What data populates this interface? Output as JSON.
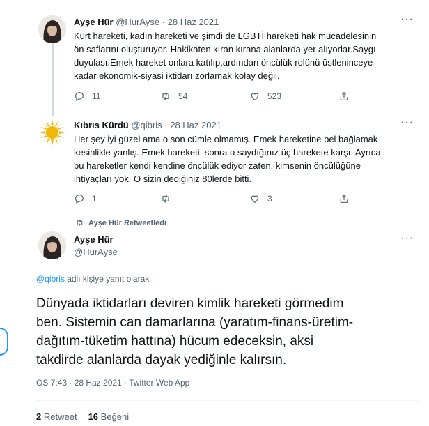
{
  "tweets": [
    {
      "name": "Ayşe Hür",
      "handle": "@HurAyse",
      "separator": "·",
      "date": "28 Haz 2021",
      "text_lines": [
        "Kürt hareketi, kadın hareketi ve şimdi de LGBTİ hareketi hak mücadelesinin",
        "ön saflarını oluşturuyor. Hakikaten kıran kırana alanlarda yer alıyorlar.Saygı",
        "duyulası.Emek hareket onlara katılıp,ardından öncülük rolünü üstleninceye",
        "kadar ekonomik-siyasi iktidarı zorlamak kolay değil."
      ],
      "replies": "11",
      "retweets": "54",
      "likes": "523"
    },
    {
      "name": "Kıbrıs Kürdü",
      "handle": "@qibris",
      "separator": "·",
      "date": "28 Haz 2021",
      "text_lines": [
        "Her şey iyi güzel ama o son cümle olmamış. Emek hareketine bel bağlamak",
        "kesinlikle yanlış. Emek hareketi, sonra o saydığınız üç harekete karşı. Ayrıca",
        "bu hareketler kendi kendine öncülük ediyor zaten, kimsenin öncülüğüne",
        "ihtiyaçları yok. O sizin dediğiniz 80lerde bitti."
      ],
      "replies": "1",
      "retweets": "",
      "likes": "3"
    }
  ],
  "retweeted_label": "Ayşe Hür Retweetledi",
  "main": {
    "name": "Ayşe Hür",
    "handle": "@HurAyse",
    "reply_mention": "@qibris",
    "reply_suffix": " adlı kişiye yanıt olarak",
    "text_lines": [
      "Dünyada iktidarları deviren kimlik hareketi görmedim",
      "ben. Sistemin can damarlarına (yaratım-finans-üretim-",
      "dağıtım-tüketim hattına) hücum edeceksin, aksi",
      "takdirde alanlarda dayak yediğinle kalırsın."
    ],
    "meta": "ÖS 7:43 · 28 Haz 2021 · Twitter Web App",
    "retweet_count": "2",
    "retweet_word": "Retweet",
    "like_count": "16",
    "like_word": "Beğeni"
  },
  "icons": {
    "more": "more-icon",
    "reply": "reply-icon",
    "retweet": "retweet-icon",
    "like": "like-icon",
    "share": "share-icon"
  }
}
